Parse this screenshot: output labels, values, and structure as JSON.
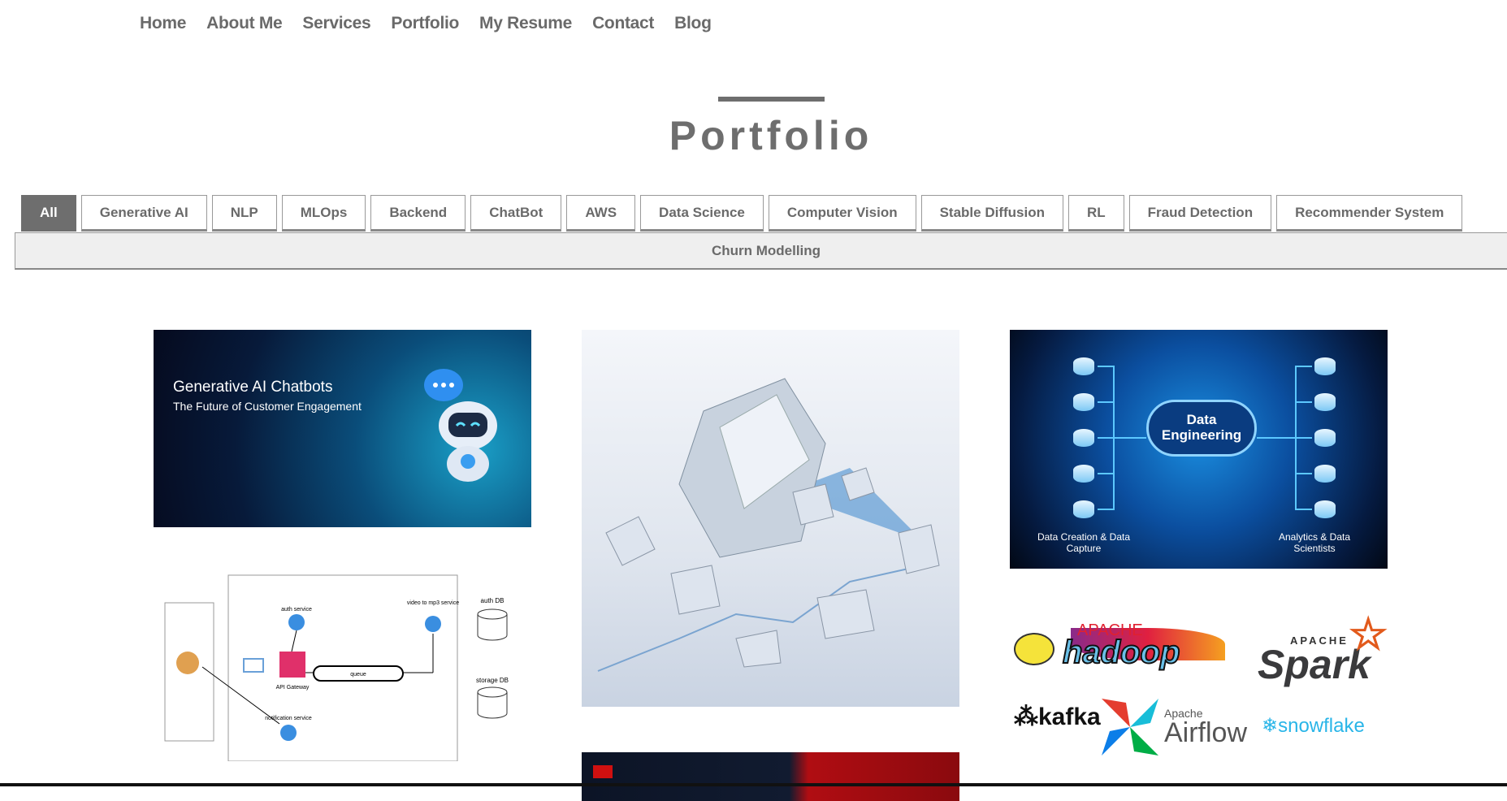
{
  "nav": [
    "Home",
    "About Me",
    "Services",
    "Portfolio",
    "My Resume",
    "Contact",
    "Blog"
  ],
  "page_title": "Portfolio",
  "filters": [
    "All",
    "Generative AI",
    "NLP",
    "MLOps",
    "Backend",
    "ChatBot",
    "AWS",
    "Data Science",
    "Computer Vision",
    "Stable Diffusion",
    "RL",
    "Fraud Detection",
    "Recommender System"
  ],
  "filters_row2": "Churn Modelling",
  "cards": {
    "chatbot": {
      "title": "Generative AI Chatbots",
      "subtitle": "The Future of Customer Engagement"
    },
    "diagram": {
      "auth": "auth service",
      "video": "video to mp3 service",
      "authdb": "auth DB",
      "storagedb": "storage DB",
      "queue": "queue",
      "gateway": "API Gateway",
      "notification": "notification service"
    },
    "data_eng": {
      "title": "Data Engineering",
      "left": "Data Creation & Data Capture",
      "right": "Analytics & Data Scientists"
    },
    "logos": {
      "hadoop": "hadoop",
      "hadoop_pre": "APACHE",
      "spark": "Spark",
      "spark_pre": "APACHE",
      "kafka": "kafka",
      "airflow": "Airflow",
      "airflow_pre": "Apache",
      "snowflake": "snowflake"
    }
  },
  "colors": {
    "text": "#6a6a6a",
    "active": "#6e6e6e"
  }
}
